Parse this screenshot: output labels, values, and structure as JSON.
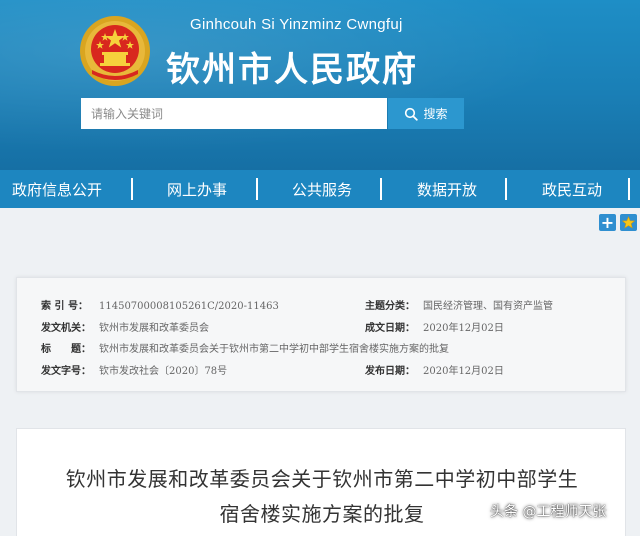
{
  "header": {
    "pinyin": "Ginhcouh Si Yinzminz Cwngfuj",
    "title": "钦州市人民政府",
    "search_placeholder": "请输入关键词",
    "search_button": "搜索",
    "emblem_icon": "national-emblem-icon",
    "colors": {
      "banner": "#1a7fb6",
      "nav": "#1d86c0",
      "search_button": "#2c97cf"
    }
  },
  "nav": {
    "items": [
      {
        "label": "政府信息公开"
      },
      {
        "label": "网上办事"
      },
      {
        "label": "公共服务"
      },
      {
        "label": "数据开放"
      },
      {
        "label": "政民互动"
      }
    ]
  },
  "toolbar": {
    "plus": "+",
    "icons": [
      "plus-icon",
      "star-icon"
    ]
  },
  "info": {
    "index_label": "索 引 号：",
    "index_value": "11450700008105261C/2020-11463",
    "category_label": "主题分类：",
    "category_value": "国民经济管理、国有资产监管",
    "issuer_label": "发文机关：",
    "issuer_value": "钦州市发展和改革委员会",
    "created_label": "成文日期：",
    "created_value": "2020年12月02日",
    "title_label": "标　　题：",
    "title_value": "钦州市发展和改革委员会关于钦州市第二中学初中部学生宿舍楼实施方案的批复",
    "docno_label": "发文字号：",
    "docno_value": "钦市发改社会〔2020〕78号",
    "published_label": "发布日期：",
    "published_value": "2020年12月02日"
  },
  "article": {
    "title_line1": "钦州市发展和改革委员会关于钦州市第二中学初中部学生",
    "title_line2": "宿舍楼实施方案的批复"
  },
  "watermark": "头条 @工程师天张"
}
